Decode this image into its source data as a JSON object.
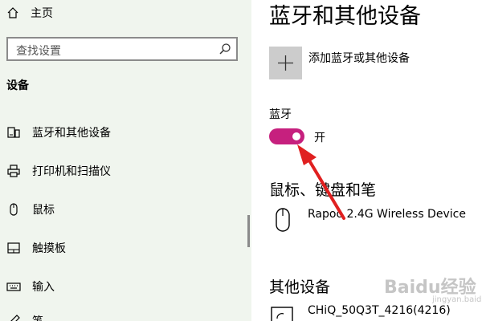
{
  "sidebar": {
    "home_label": "主页",
    "search_placeholder": "查找设置",
    "section_title": "设备",
    "items": [
      {
        "label": "蓝牙和其他设备",
        "icon": "bluetooth-devices-icon"
      },
      {
        "label": "打印机和扫描仪",
        "icon": "printer-icon"
      },
      {
        "label": "鼠标",
        "icon": "mouse-icon"
      },
      {
        "label": "触摸板",
        "icon": "touchpad-icon"
      },
      {
        "label": "输入",
        "icon": "keyboard-icon"
      },
      {
        "label": "笔",
        "icon": "pen-icon"
      }
    ]
  },
  "main": {
    "title": "蓝牙和其他设备",
    "add_device_label": "添加蓝牙或其他设备",
    "bluetooth": {
      "title": "蓝牙",
      "state_label": "开",
      "on": true,
      "accent_color": "#c6207e"
    },
    "mouse_section": {
      "title": "鼠标、键盘和笔",
      "device": "Rapoo 2.4G Wireless Device"
    },
    "other_section": {
      "title": "其他设备",
      "device": "CHiQ_50Q3T_4216(4216)"
    }
  },
  "annotation": {
    "arrow_color": "#e02020"
  },
  "watermark": {
    "text": "Baidu经验",
    "sub": "jingyan.baidu.com"
  }
}
